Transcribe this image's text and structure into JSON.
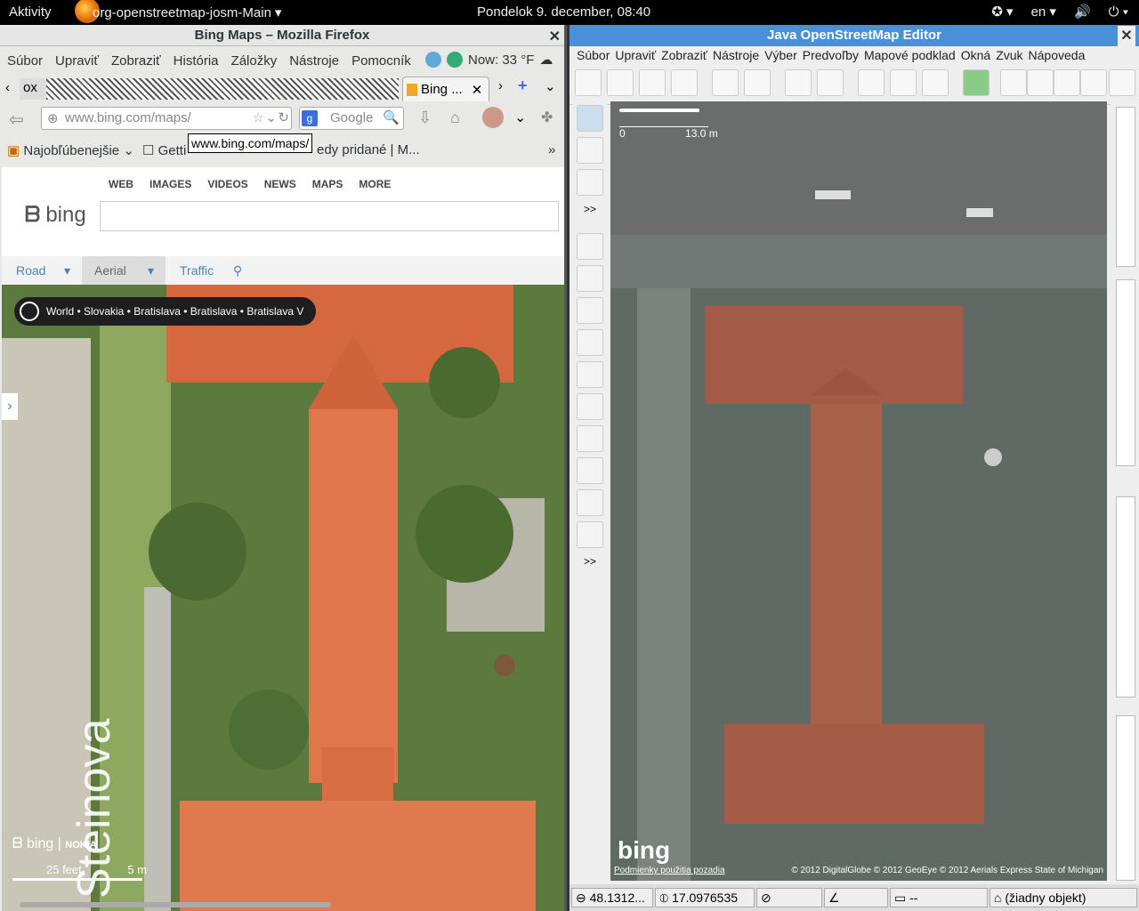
{
  "topbar": {
    "activities": "Aktivity",
    "app_name": "org-openstreetmap-josm-Main",
    "clock": "Pondelok  9. december, 08:40",
    "lang": "en"
  },
  "firefox": {
    "title": "Bing Maps – Mozilla Firefox",
    "menu": [
      "Súbor",
      "Upraviť",
      "Zobraziť",
      "História",
      "Záložky",
      "Nástroje",
      "Pomocník"
    ],
    "weather": "Now: 33 °F",
    "old_tab": "ox",
    "tab_label": "Bing ...",
    "url": "www.bing.com/maps/",
    "search_placeholder": "Google",
    "bookmarks": [
      "Najobľúbenejšie",
      "Getti",
      "edy pridané | M..."
    ],
    "tooltip": "www.bing.com/maps/",
    "bing": {
      "nav": [
        "WEB",
        "IMAGES",
        "VIDEOS",
        "NEWS",
        "MAPS",
        "MORE"
      ],
      "logo": "bing",
      "map_modes": [
        "Road",
        "Aerial",
        "Traffic"
      ],
      "breadcrumb": "World • Slovakia • Bratislava • Bratislava • Bratislava V",
      "street_label": "Steinova",
      "scale_feet": "25 feet",
      "scale_m": "5 m",
      "logo_small": "bing"
    }
  },
  "josm": {
    "title": "Java OpenStreetMap Editor",
    "menu": [
      "Súbor",
      "Upraviť",
      "Zobraziť",
      "Nástroje",
      "Výber",
      "Predvoľby",
      "Mapové podklad",
      "Okná",
      "Zvuk",
      "Nápoveda"
    ],
    "scale_start": "0",
    "scale_end": "13.0 m",
    "more_label": ">>",
    "bing_logo": "bing",
    "terms": "Podmienky použitia pozadia",
    "attribution": "© 2012 DigitalGlobe © 2012 GeoEye © 2012 Aerials Express State of Michigan",
    "status": {
      "lat": "48.1312...",
      "lon": "17.0976535",
      "dist": "--",
      "object": "(žiadny objekt)"
    }
  }
}
